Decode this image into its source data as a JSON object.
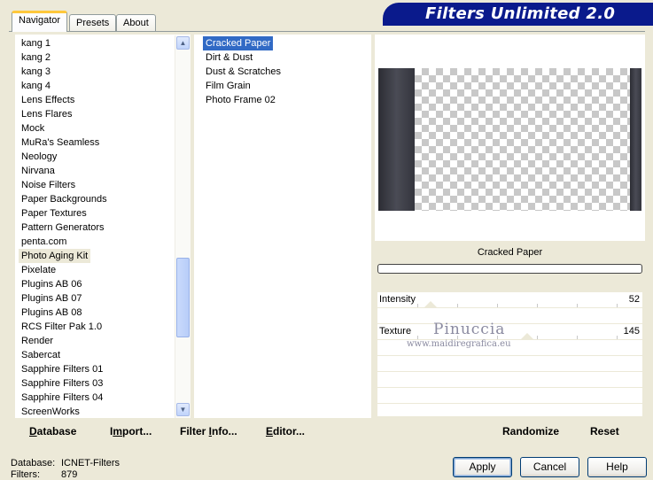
{
  "tabs": [
    {
      "label": "Navigator"
    },
    {
      "label": "Presets"
    },
    {
      "label": "About"
    }
  ],
  "banner_title": "Filters Unlimited 2.0",
  "categories": [
    "kang 1",
    "kang 2",
    "kang 3",
    "kang 4",
    "Lens Effects",
    "Lens Flares",
    "Mock",
    "MuRa's Seamless",
    "Neology",
    "Nirvana",
    "Noise Filters",
    "Paper Backgrounds",
    "Paper Textures",
    "Pattern Generators",
    "penta.com",
    "Photo Aging Kit",
    "Pixelate",
    "Plugins AB 06",
    "Plugins AB 07",
    "Plugins AB 08",
    "RCS Filter Pak 1.0",
    "Render",
    "Sabercat",
    "Sapphire Filters 01",
    "Sapphire Filters 03",
    "Sapphire Filters 04",
    "ScreenWorks"
  ],
  "selected_category": "Photo Aging Kit",
  "filters": [
    "Cracked Paper",
    "Dirt & Dust",
    "Dust & Scratches",
    "Film Grain",
    "Photo Frame 02"
  ],
  "selected_filter": "Cracked Paper",
  "preview_filter_name": "Cracked Paper",
  "params": [
    {
      "label": "Intensity",
      "value": "52"
    },
    {
      "label": "Texture",
      "value": "145"
    }
  ],
  "watermark": {
    "name": "Pinuccia",
    "url": "www.maidiregrafica.eu"
  },
  "bottom_left": {
    "database_pre": "D",
    "database_rest": "atabase",
    "import_pre": "I",
    "import_mid": "m",
    "import_rest": "port...",
    "filterinfo_pre": "Filter ",
    "filterinfo_u": "I",
    "filterinfo_rest": "nfo...",
    "editor_pre": "E",
    "editor_rest": "ditor..."
  },
  "bottom_right": {
    "randomize": "Randomize",
    "reset": "Reset"
  },
  "status": {
    "database_label": "Database:",
    "database_value": "ICNET-Filters",
    "filters_label": "Filters:",
    "filters_value": "879"
  },
  "buttons": {
    "apply": "Apply",
    "cancel": "Cancel",
    "help": "Help"
  },
  "colors": {
    "selection_blue": "#316ac5",
    "banner_blue": "#0a1a8c",
    "dialog_bg": "#ece9d8"
  }
}
